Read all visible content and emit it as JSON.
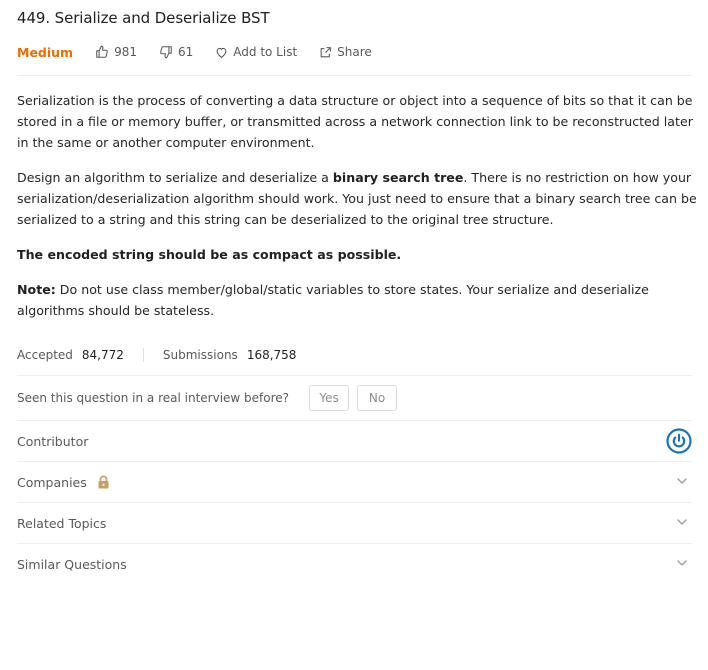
{
  "problem": {
    "title": "449. Serialize and Deserialize BST",
    "difficulty": "Medium",
    "likes": "981",
    "dislikes": "61",
    "add_to_list": "Add to List",
    "share": "Share"
  },
  "description": {
    "p1": "Serialization is the process of converting a data structure or object into a sequence of bits so that it can be stored in a file or memory buffer, or transmitted across a network connection link to be reconstructed later in the same or another computer environment.",
    "p2_before": "Design an algorithm to serialize and deserialize a ",
    "p2_bold": "binary search tree",
    "p2_after": ". There is no restriction on how your serialization/deserialization algorithm should work. You just need to ensure that a binary search tree can be serialized to a string and this string can be deserialized to the original tree structure.",
    "p3_bold": "The encoded string should be as compact as possible.",
    "p4_bold": "Note:",
    "p4_after": " Do not use class member/global/static variables to store states. Your serialize and deserialize algorithms should be stateless."
  },
  "stats": {
    "accepted_label": "Accepted",
    "accepted_value": "84,772",
    "submissions_label": "Submissions",
    "submissions_value": "168,758"
  },
  "interview": {
    "question": "Seen this question in a real interview before?",
    "yes": "Yes",
    "no": "No"
  },
  "sections": {
    "contributor": "Contributor",
    "companies": "Companies",
    "related_topics": "Related Topics",
    "similar_questions": "Similar Questions"
  },
  "colors": {
    "difficulty": "#ef6c00",
    "contributor_icon": "#1a73b8",
    "lock": "#c9a063"
  },
  "icons": {
    "like": "thumbs-up-icon",
    "dislike": "thumbs-down-icon",
    "add_to_list": "heart-icon",
    "share": "share-icon",
    "lock": "lock-icon",
    "contributor": "power-icon",
    "expand": "chevron-down-icon"
  }
}
